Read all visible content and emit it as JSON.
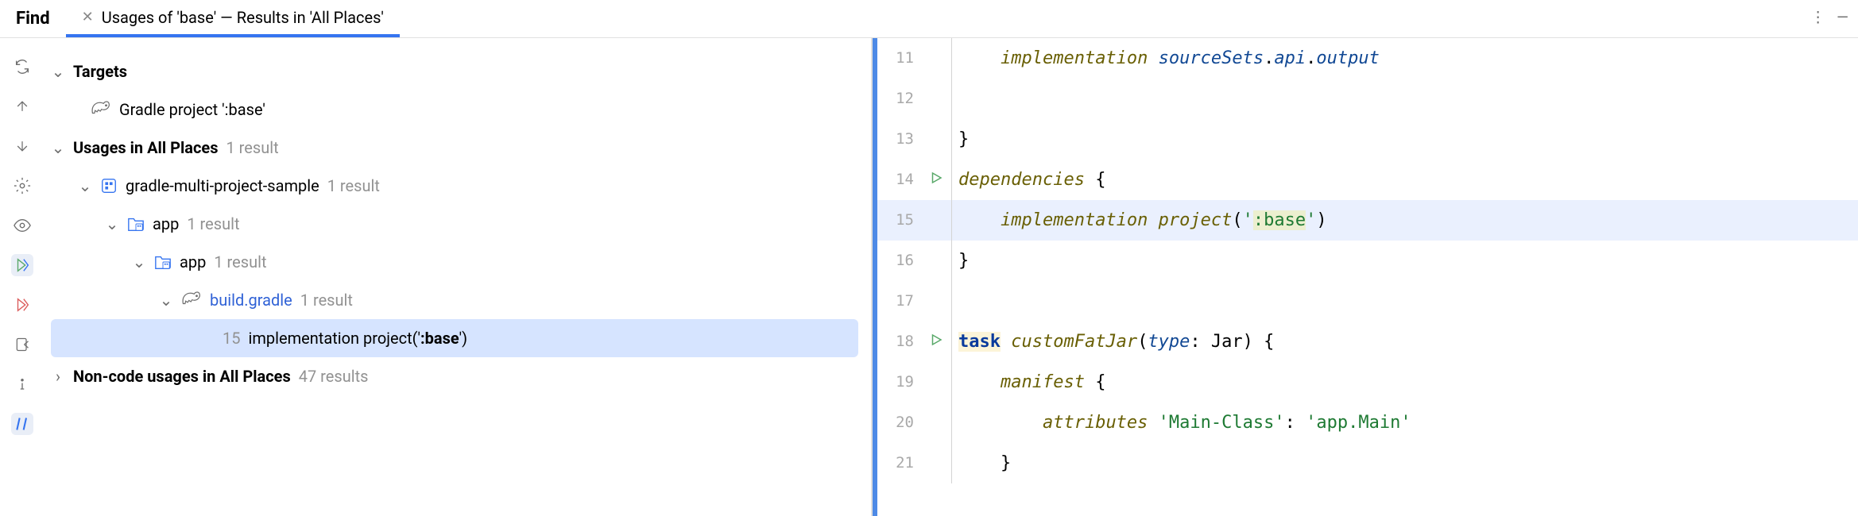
{
  "tabs": {
    "find": "Find",
    "title": "Usages of 'base' — Results in 'All Places'"
  },
  "tree": {
    "targets": "Targets",
    "target_item": "Gradle project ':base'",
    "usages_label": "Usages in All Places",
    "usages_count": "1 result",
    "proj": "gradle-multi-project-sample",
    "proj_count": "1 result",
    "app1": "app",
    "app1_count": "1 result",
    "app2": "app",
    "app2_count": "1 result",
    "file": "build.gradle",
    "file_count": "1 result",
    "result_line": "15",
    "result_prefix": "implementation project('",
    "result_hit": ":base",
    "result_suffix": "')",
    "noncode": "Non-code usages in All Places",
    "noncode_count": "47 results"
  },
  "code": {
    "l11": {
      "n": "11",
      "indent": "    ",
      "call": "implementation",
      "sp": " ",
      "p1": "sourceSets",
      "d1": ".",
      "p2": "api",
      "d2": ".",
      "p3": "output"
    },
    "l12": {
      "n": "12"
    },
    "l13": {
      "n": "13",
      "t": "}"
    },
    "l14": {
      "n": "14",
      "call": "dependencies",
      "sp": " {"
    },
    "l15": {
      "n": "15",
      "indent": "    ",
      "call": "implementation",
      "sp": " ",
      "fn": "project",
      "open": "(",
      "s1": "'",
      "hit": ":base",
      "s2": "'",
      "close": ")"
    },
    "l16": {
      "n": "16",
      "t": "}"
    },
    "l17": {
      "n": "17"
    },
    "l18": {
      "n": "18",
      "task": "task",
      "sp1": " ",
      "name": "customFatJar",
      "open": "(",
      "typek": "type",
      "colon": ": ",
      "jar": "Jar",
      "close": ") {"
    },
    "l19": {
      "n": "19",
      "indent": "    ",
      "call": "manifest",
      "sp": " {"
    },
    "l20": {
      "n": "20",
      "indent": "        ",
      "call": "attributes",
      "sp": " ",
      "s1": "'Main-Class'",
      "colon": ": ",
      "s2": "'app.Main'"
    },
    "l21": {
      "n": "21",
      "indent": "    ",
      "t": "}"
    }
  }
}
